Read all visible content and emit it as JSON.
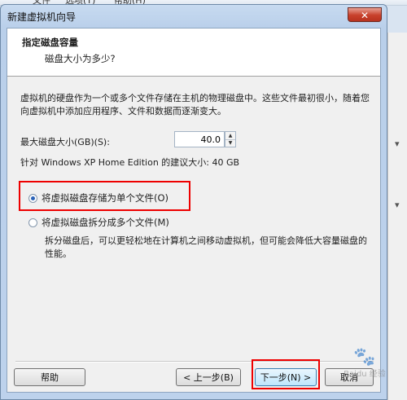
{
  "app_menu": {
    "item1": "文件",
    "item2": "选项(T)",
    "item3": "帮助(H)"
  },
  "window": {
    "title": "新建虚拟机向导",
    "close_glyph": "✕"
  },
  "header": {
    "title": "指定磁盘容量",
    "subtitle": "磁盘大小为多少?"
  },
  "description": "虚拟机的硬盘作为一个或多个文件存储在主机的物理磁盘中。这些文件最初很小，随着您向虚拟机中添加应用程序、文件和数据而逐渐变大。",
  "disk_size": {
    "label": "最大磁盘大小(GB)(S):",
    "value": "40.0",
    "recommend": "针对 Windows XP Home Edition 的建议大小: 40 GB"
  },
  "options": {
    "single_file": {
      "label": "将虚拟磁盘存储为单个文件(O)",
      "checked": true
    },
    "split_files": {
      "label": "将虚拟磁盘拆分成多个文件(M)",
      "checked": false,
      "description": "拆分磁盘后，可以更轻松地在计算机之间移动虚拟机，但可能会降低大容量磁盘的性能。"
    }
  },
  "buttons": {
    "help": "帮助",
    "back": "< 上一步(B)",
    "next": "下一步(N) >",
    "cancel": "取消"
  },
  "watermark": {
    "glyph": "🐾",
    "text": "Baidu 经验"
  },
  "colors": {
    "highlight": "#ee0000",
    "accent": "#2b63b8"
  }
}
